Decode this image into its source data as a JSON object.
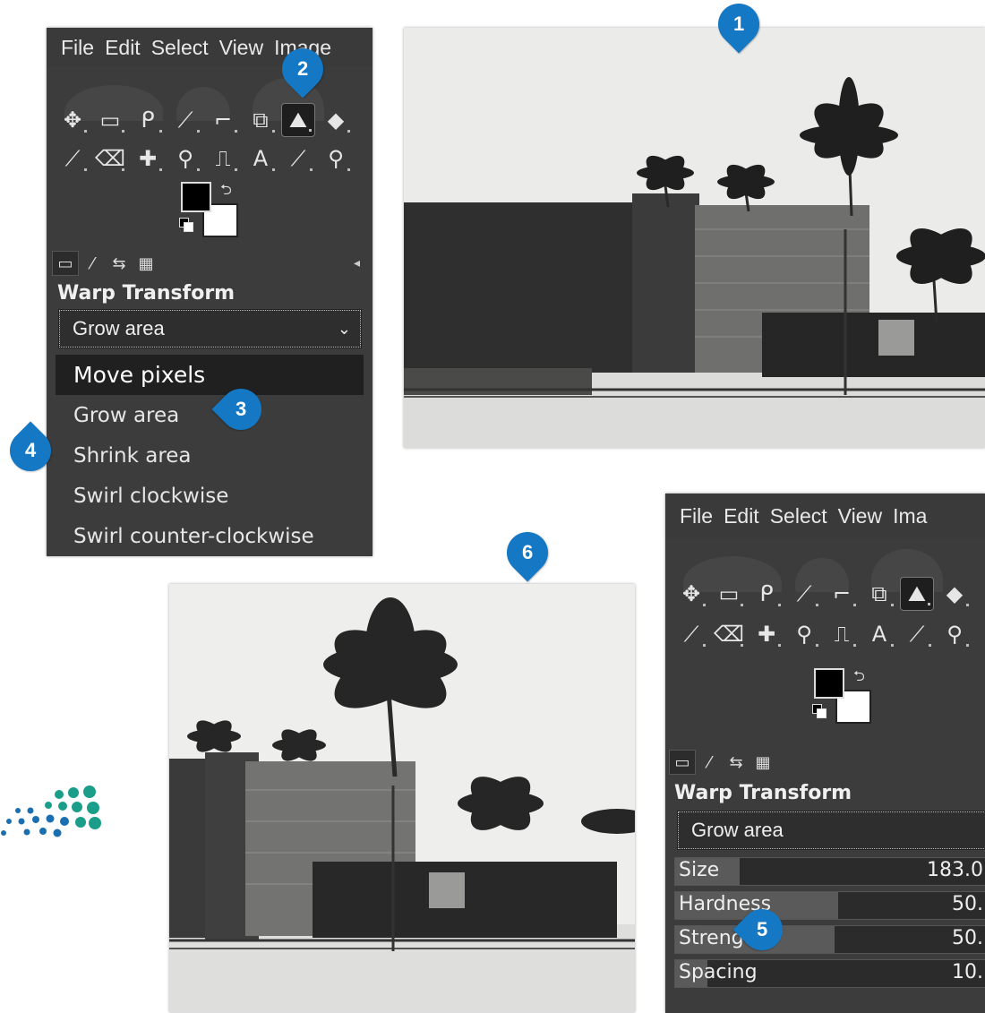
{
  "panel1": {
    "menu": [
      "File",
      "Edit",
      "Select",
      "View",
      "Image"
    ],
    "tool_options_title": "Warp Transform",
    "mode_value": "Grow area",
    "dropdown_items": [
      "Move pixels",
      "Grow area",
      "Shrink area",
      "Swirl clockwise",
      "Swirl counter-clockwise"
    ],
    "highlighted_item": "Move pixels"
  },
  "panel2": {
    "menu": [
      "File",
      "Edit",
      "Select",
      "View",
      "Ima"
    ],
    "tool_options_title": "Warp Transform",
    "mode_value": "Grow area",
    "sliders": [
      {
        "label": "Size",
        "value": "183.0"
      },
      {
        "label": "Hardness",
        "value": "50."
      },
      {
        "label": "Strength",
        "value": "50."
      },
      {
        "label": "Spacing",
        "value": "10."
      }
    ]
  },
  "tools_row1": [
    "move-tool-icon",
    "rect-select-icon",
    "free-select-icon",
    "fuzzy-select-icon",
    "crop-icon",
    "unified-transform-icon",
    "warp-transform-icon",
    "bucket-fill-icon"
  ],
  "tools_row2": [
    "paintbrush-icon",
    "eraser-icon",
    "heal-icon",
    "smudge-icon",
    "paths-icon",
    "text-icon",
    "color-picker-icon",
    "zoom-icon"
  ],
  "tool_glyphs_row1": [
    "✥",
    "▭",
    "ᑭ",
    "⟋",
    "⌐",
    "⧉",
    "⛰",
    "◆"
  ],
  "tool_glyphs_row2": [
    "⟋",
    "⌫",
    "✚",
    "⚲",
    "⎍",
    "A",
    "⟋",
    "⚲"
  ],
  "callouts": [
    "1",
    "2",
    "3",
    "4",
    "5",
    "6"
  ],
  "colors": {
    "accent": "#1478c4",
    "panel": "#3c3c3c",
    "logo_teal": "#1a9e8a",
    "logo_blue": "#1a6fb0"
  }
}
